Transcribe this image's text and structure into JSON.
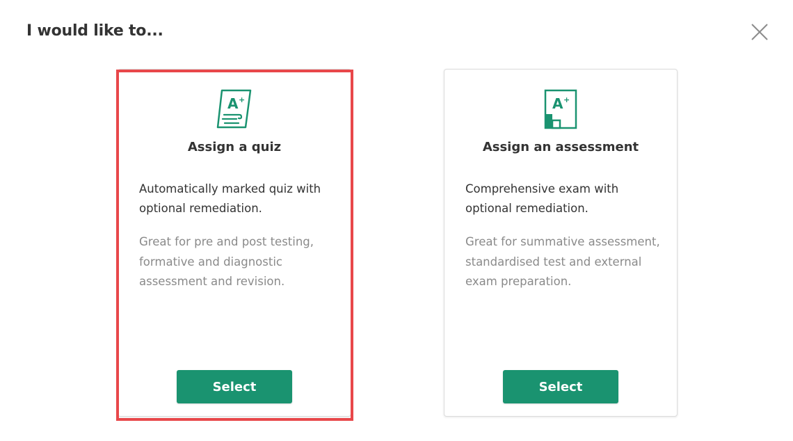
{
  "dialog": {
    "title": "I would like to...",
    "close_icon": "close-icon"
  },
  "cards": [
    {
      "id": "quiz",
      "icon": "quiz-grade-icon",
      "icon_text": "A",
      "title": "Assign a quiz",
      "description": "Automatically marked quiz with optional remediation.",
      "note": "Great for pre and post testing, formative and diagnostic assessment and revision.",
      "button_label": "Select",
      "highlighted": true
    },
    {
      "id": "assessment",
      "icon": "assessment-grade-icon",
      "icon_text": "A",
      "title": "Assign an assessment",
      "description": "Comprehensive exam with optional remediation.",
      "note": "Great for summative assessment, standardised test and external exam preparation.",
      "button_label": "Select",
      "highlighted": false
    }
  ],
  "colors": {
    "accent": "#1a9370",
    "highlight_border": "#e8474a",
    "title_text": "#333333",
    "muted_text": "#8a8a8a"
  }
}
